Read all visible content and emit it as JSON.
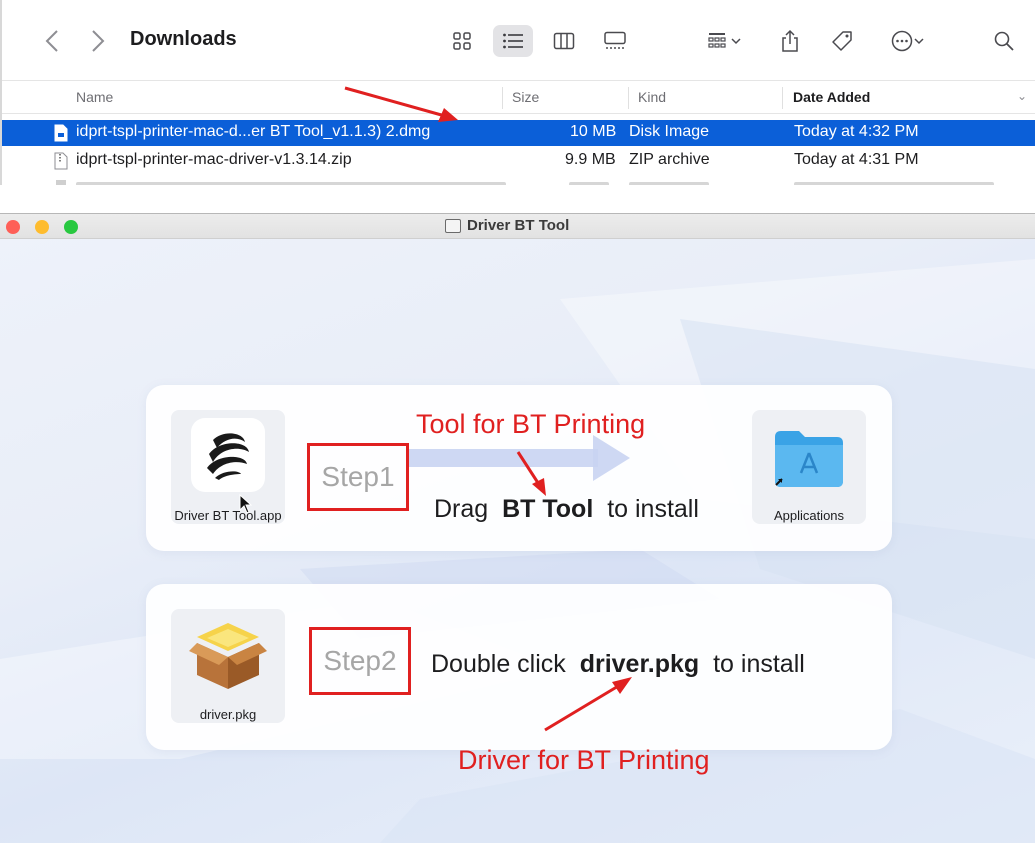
{
  "finder": {
    "folder_title": "Downloads",
    "columns": {
      "name": "Name",
      "size": "Size",
      "kind": "Kind",
      "date_added": "Date Added"
    },
    "rows": [
      {
        "name": "idprt-tspl-printer-mac-d...er BT Tool_v1.1.3) 2.dmg",
        "size": "10 MB",
        "kind": "Disk Image",
        "date": "Today at 4:32 PM",
        "selected": true
      },
      {
        "name": "idprt-tspl-printer-mac-driver-v1.3.14.zip",
        "size": "9.9 MB",
        "kind": "ZIP archive",
        "date": "Today at 4:31 PM",
        "selected": false
      }
    ],
    "icons": [
      "chevron-left-icon",
      "chevron-right-icon",
      "icon-view-icon",
      "list-view-icon",
      "column-view-icon",
      "gallery-view-icon",
      "group-icon",
      "share-icon",
      "tag-icon",
      "more-icon",
      "search-icon"
    ],
    "selection_color": "#0b5fd8"
  },
  "dmg": {
    "window_title": "Driver BT Tool",
    "step1": {
      "app_label": "Driver BT Tool.app",
      "step_label": "Step1",
      "instruction_pre": "Drag",
      "instruction_bold": "BT Tool",
      "instruction_post": "to install",
      "target_label": "Applications",
      "callout": "Tool for BT Printing"
    },
    "step2": {
      "pkg_label": "driver.pkg",
      "step_label": "Step2",
      "instruction_pre": "Double click",
      "instruction_bold": "driver.pkg",
      "instruction_post": "to install",
      "callout": "Driver for BT Printing"
    },
    "annotation_color": "#e02020"
  }
}
